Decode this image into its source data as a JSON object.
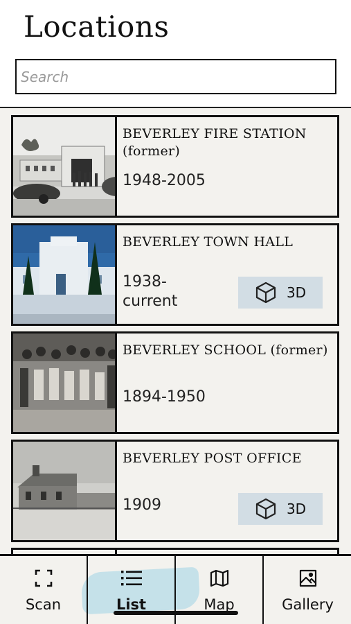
{
  "header": {
    "title": "Locations",
    "search_placeholder": "Search"
  },
  "locations": [
    {
      "name": "BEVERLEY FIRE STATION (former)",
      "years": "1948-2005",
      "has_3d": false
    },
    {
      "name": "BEVERLEY TOWN HALL",
      "years": "1938-\ncurrent",
      "has_3d": true,
      "button_label": "3D"
    },
    {
      "name": "BEVERLEY SCHOOL (former)",
      "years": "1894-1950",
      "has_3d": false
    },
    {
      "name": "BEVERLEY POST OFFICE",
      "years": "1909",
      "has_3d": true,
      "button_label": "3D"
    }
  ],
  "tabs": [
    {
      "label": "Scan",
      "icon": "scan-icon",
      "active": false
    },
    {
      "label": "List",
      "icon": "list-icon",
      "active": true
    },
    {
      "label": "Map",
      "icon": "map-icon",
      "active": false
    },
    {
      "label": "Gallery",
      "icon": "gallery-icon",
      "active": false
    }
  ],
  "colors": {
    "background": "#f3f2ee",
    "button_3d": "#d2dde4",
    "active_tab_highlight": "#9fd3e6"
  }
}
